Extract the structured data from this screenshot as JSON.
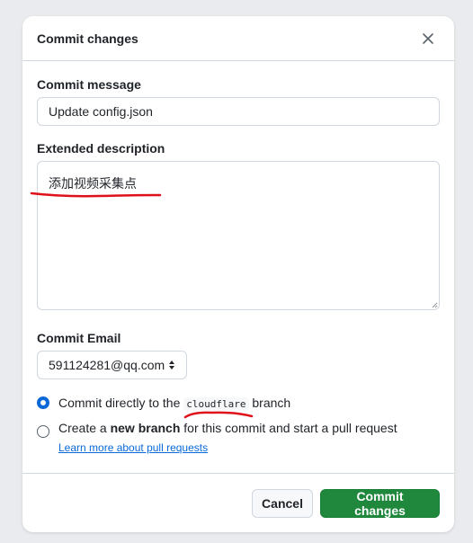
{
  "dialog": {
    "title": "Commit changes",
    "close_icon": "x-icon"
  },
  "commit_message": {
    "label": "Commit message",
    "value": "Update config.json"
  },
  "extended_description": {
    "label": "Extended description",
    "value": "添加视频采集点"
  },
  "commit_email": {
    "label": "Commit Email",
    "selected": "591124281@qq.com"
  },
  "branch_options": {
    "direct_prefix": "Commit directly to the ",
    "branch_name": "cloudflare",
    "direct_suffix": " branch",
    "new_prefix": "Create a ",
    "new_bold": "new branch",
    "new_suffix": " for this commit and start a pull request ",
    "learn_more": "Learn more about pull requests"
  },
  "footer": {
    "cancel": "Cancel",
    "commit": "Commit changes"
  },
  "colors": {
    "primary": "#1f883d",
    "link": "#0969da",
    "annotation": "#e0101a"
  }
}
